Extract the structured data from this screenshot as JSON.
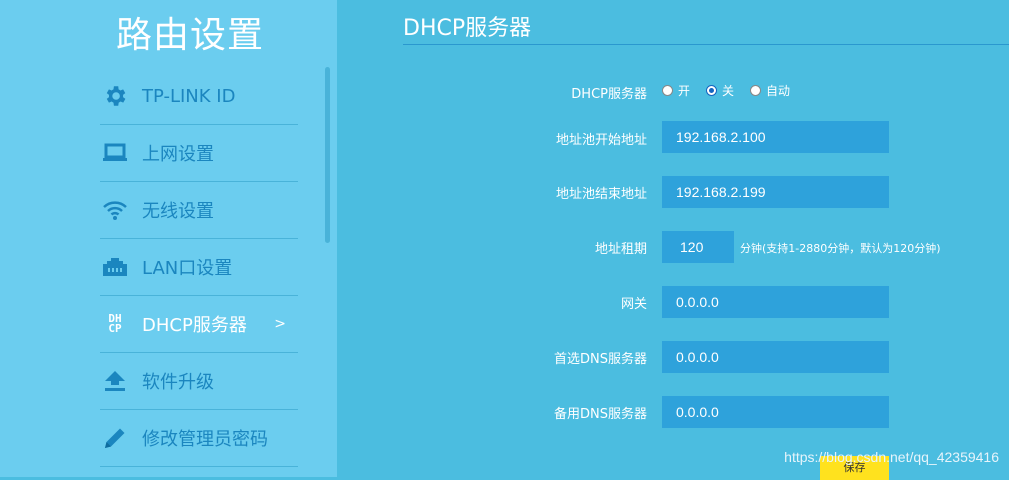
{
  "sidebar": {
    "title": "路由设置",
    "items": [
      {
        "label": "TP-LINK ID",
        "icon": "gear-icon"
      },
      {
        "label": "上网设置",
        "icon": "laptop-icon"
      },
      {
        "label": "无线设置",
        "icon": "wifi-icon"
      },
      {
        "label": "LAN口设置",
        "icon": "lan-port-icon"
      },
      {
        "label": "DHCP服务器",
        "icon": "dhcp-icon",
        "icon_text_top": "DH",
        "icon_text_bottom": "CP",
        "active": true,
        "arrow": ">"
      },
      {
        "label": "软件升级",
        "icon": "upload-icon"
      },
      {
        "label": "修改管理员密码",
        "icon": "pencil-icon"
      }
    ]
  },
  "main": {
    "title": "DHCP服务器",
    "dhcp_switch": {
      "label": "DHCP服务器",
      "options": [
        "开",
        "关",
        "自动"
      ],
      "selected": "关"
    },
    "fields": {
      "pool_start": {
        "label": "地址池开始地址",
        "value": "192.168.2.100"
      },
      "pool_end": {
        "label": "地址池结束地址",
        "value": "192.168.2.199"
      },
      "lease": {
        "label": "地址租期",
        "value": "120",
        "hint": "分钟(支持1-2880分钟，默认为120分钟)"
      },
      "gateway": {
        "label": "网关",
        "value": "0.0.0.0"
      },
      "dns_primary": {
        "label": "首选DNS服务器",
        "value": "0.0.0.0"
      },
      "dns_backup": {
        "label": "备用DNS服务器",
        "value": "0.0.0.0"
      }
    },
    "save_label": "保存"
  },
  "watermark": "https://blog.csdn.net/qq_42359416",
  "colors": {
    "sidebar_bg": "#6bcdef",
    "main_bg": "#4bbde0",
    "field_bg": "#2ea2db",
    "menu_text": "#1b86bf",
    "save_bg": "#ffe21e"
  }
}
